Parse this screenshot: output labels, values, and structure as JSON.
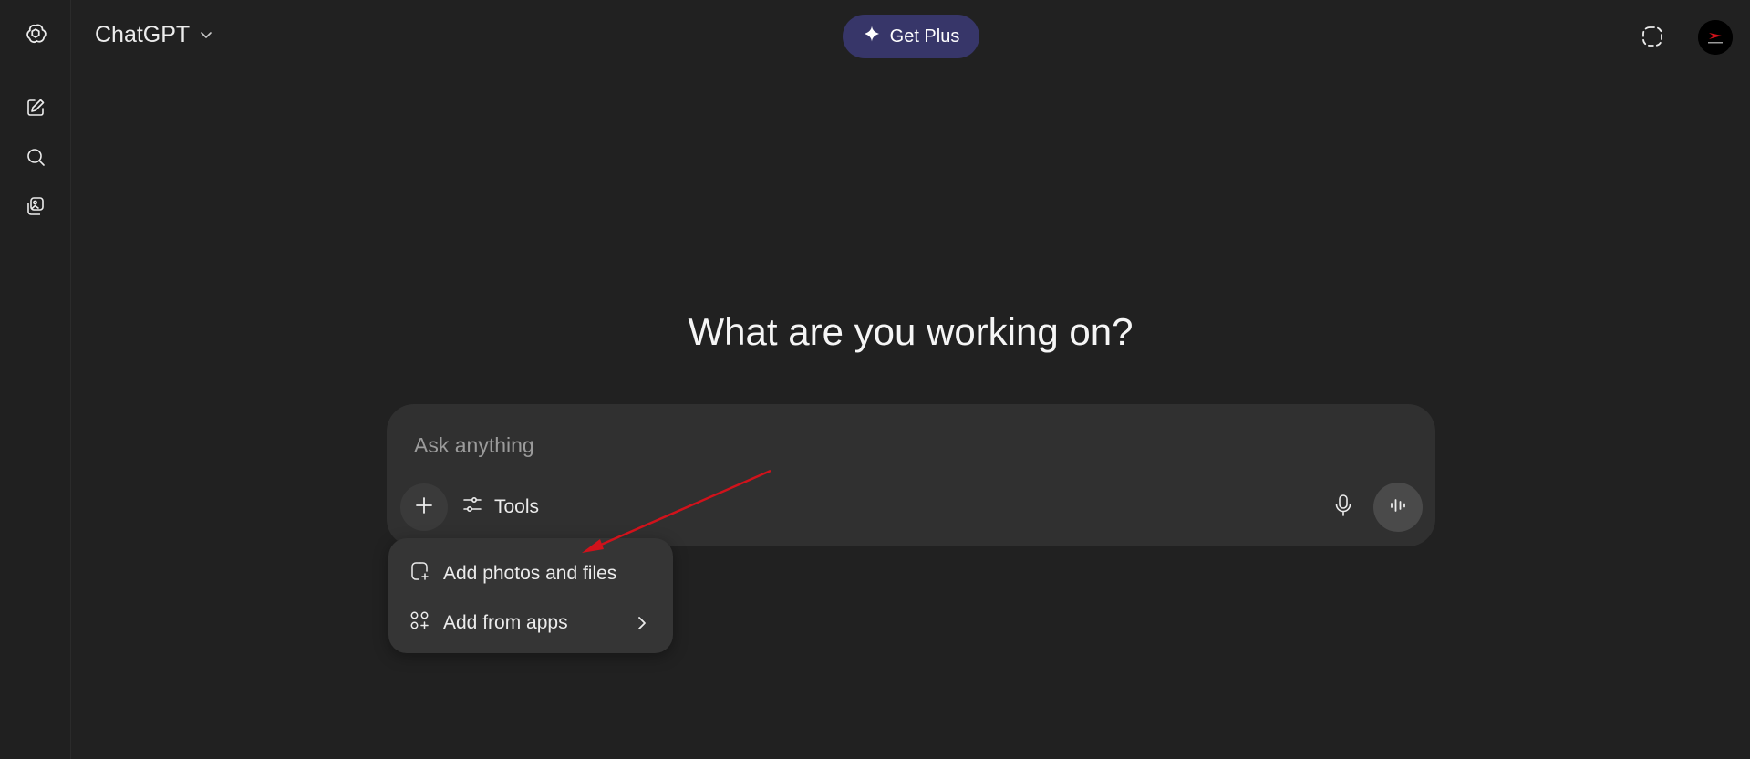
{
  "header": {
    "model_name": "ChatGPT",
    "model_chevron_icon": "chevron-down-icon",
    "upgrade_label": "Get Plus",
    "upgrade_icon": "sparkle-icon",
    "upgrade_color": "#373669"
  },
  "sidebar": {
    "logo_icon": "openai-logo-icon",
    "items": [
      {
        "icon": "new-chat-icon"
      },
      {
        "icon": "search-icon"
      },
      {
        "icon": "library-icon"
      }
    ]
  },
  "main": {
    "heading": "What are you working on?"
  },
  "composer": {
    "placeholder": "Ask anything",
    "tools_label": "Tools",
    "plus_icon": "plus-icon",
    "tools_icon": "sliders-icon",
    "mic_icon": "microphone-icon",
    "voice_icon": "voice-mode-icon"
  },
  "attach_menu": {
    "items": [
      {
        "label": "Add photos and files",
        "icon": "attach-file-icon"
      },
      {
        "label": "Add from apps",
        "icon": "apps-icon",
        "has_submenu": true
      }
    ]
  },
  "annotation": {
    "arrow_color": "#d0121b"
  },
  "theme": {
    "background": "#212121",
    "composer_bg": "#303030",
    "menu_bg": "#353535"
  }
}
